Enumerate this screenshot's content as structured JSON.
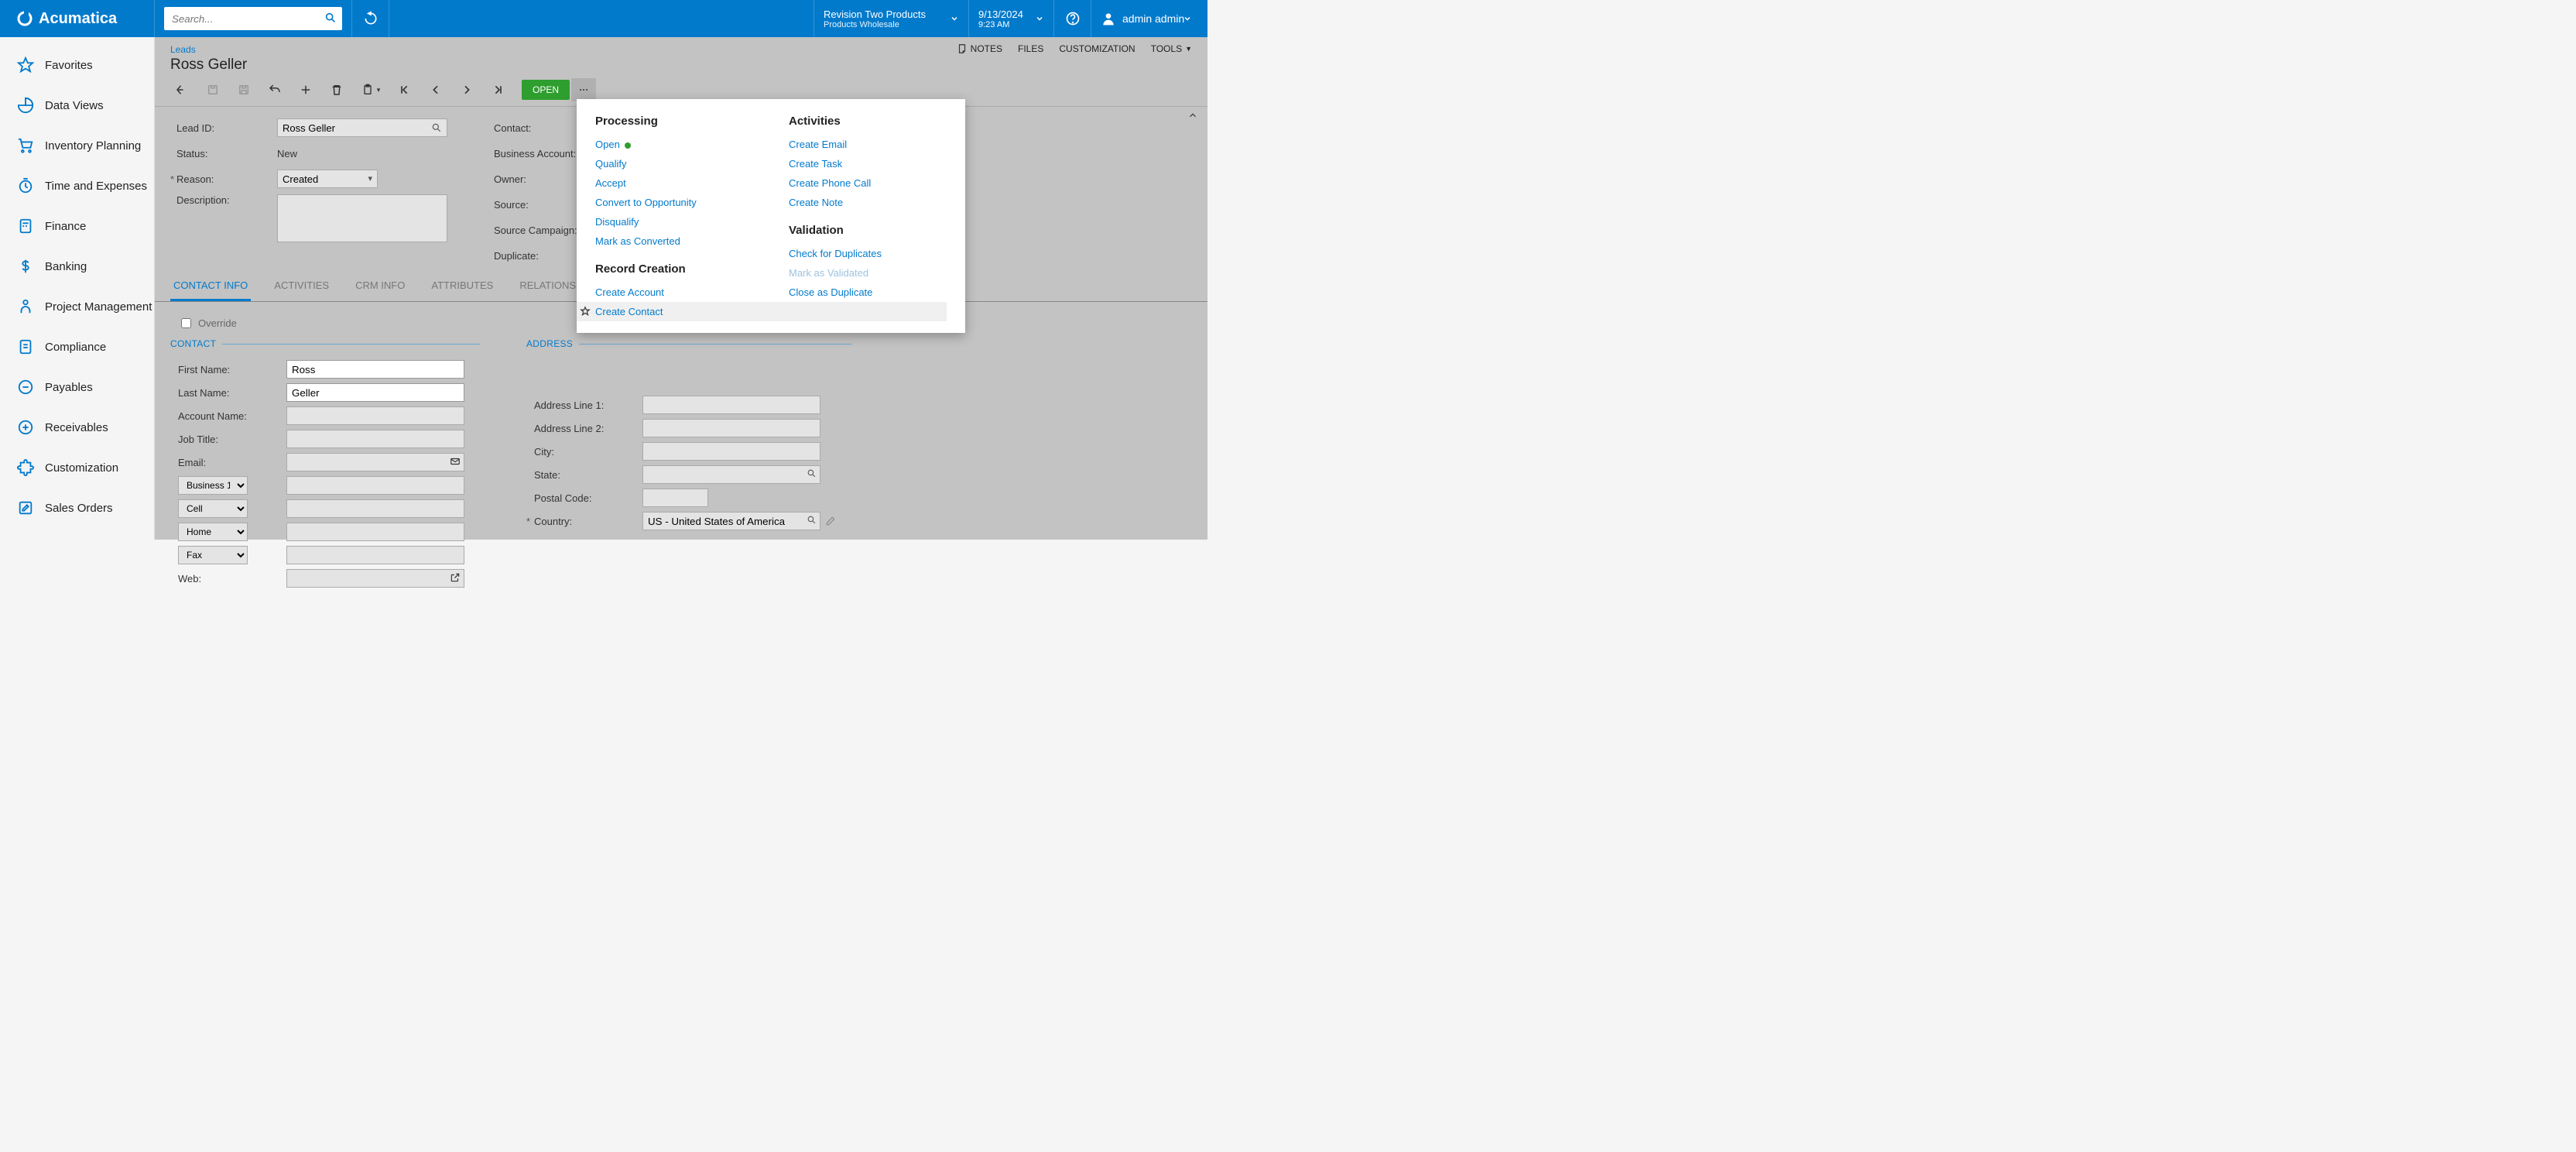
{
  "brand": "Acumatica",
  "search": {
    "placeholder": "Search..."
  },
  "context": {
    "company": "Revision Two Products",
    "branch": "Products Wholesale"
  },
  "datetime": {
    "date": "9/13/2024",
    "time": "9:23 AM"
  },
  "user": {
    "name": "admin admin"
  },
  "nav": [
    {
      "label": "Favorites",
      "icon": "star"
    },
    {
      "label": "Data Views",
      "icon": "pie"
    },
    {
      "label": "Inventory Planning",
      "icon": "cart"
    },
    {
      "label": "Time and Expenses",
      "icon": "clock"
    },
    {
      "label": "Finance",
      "icon": "calc"
    },
    {
      "label": "Banking",
      "icon": "dollar"
    },
    {
      "label": "Project Management",
      "icon": "person"
    },
    {
      "label": "Compliance",
      "icon": "checklist"
    },
    {
      "label": "Payables",
      "icon": "minus"
    },
    {
      "label": "Receivables",
      "icon": "plus"
    },
    {
      "label": "Customization",
      "icon": "puzzle"
    },
    {
      "label": "Sales Orders",
      "icon": "edit"
    }
  ],
  "breadcrumb": "Leads",
  "record_title": "Ross Geller",
  "top_actions": {
    "notes": "NOTES",
    "files": "FILES",
    "customization": "CUSTOMIZATION",
    "tools": "TOOLS"
  },
  "toolbar": {
    "open_btn": "OPEN"
  },
  "summary": {
    "labels": {
      "lead_id": "Lead ID:",
      "status": "Status:",
      "reason": "Reason:",
      "description": "Description:",
      "contact": "Contact:",
      "business_account": "Business Account:",
      "owner": "Owner:",
      "source": "Source:",
      "source_campaign": "Source Campaign:",
      "duplicate": "Duplicate:"
    },
    "lead_id": "Ross Geller",
    "status": "New",
    "reason": "Created"
  },
  "tabs": [
    "CONTACT INFO",
    "ACTIVITIES",
    "CRM INFO",
    "ATTRIBUTES",
    "RELATIONS"
  ],
  "override_label": "Override",
  "contact_section": {
    "title": "CONTACT",
    "labels": {
      "first_name": "First Name:",
      "last_name": "Last Name:",
      "account_name": "Account Name:",
      "job_title": "Job Title:",
      "email": "Email:",
      "web": "Web:"
    },
    "first_name": "Ross",
    "last_name": "Geller",
    "phone_types": [
      "Business 1",
      "Cell",
      "Home",
      "Fax"
    ]
  },
  "address_section": {
    "title": "ADDRESS",
    "labels": {
      "line1": "Address Line 1:",
      "line2": "Address Line 2:",
      "city": "City:",
      "state": "State:",
      "postal": "Postal Code:",
      "country": "Country:"
    },
    "country": "US - United States of America"
  },
  "popup": {
    "processing": {
      "title": "Processing",
      "items": [
        "Open",
        "Qualify",
        "Accept",
        "Convert to Opportunity",
        "Disqualify",
        "Mark as Converted"
      ]
    },
    "record_creation": {
      "title": "Record Creation",
      "items": [
        "Create Account",
        "Create Contact"
      ]
    },
    "activities": {
      "title": "Activities",
      "items": [
        "Create Email",
        "Create Task",
        "Create Phone Call",
        "Create Note"
      ]
    },
    "validation": {
      "title": "Validation",
      "items": [
        "Check for Duplicates",
        "Mark as Validated",
        "Close as Duplicate"
      ]
    }
  }
}
